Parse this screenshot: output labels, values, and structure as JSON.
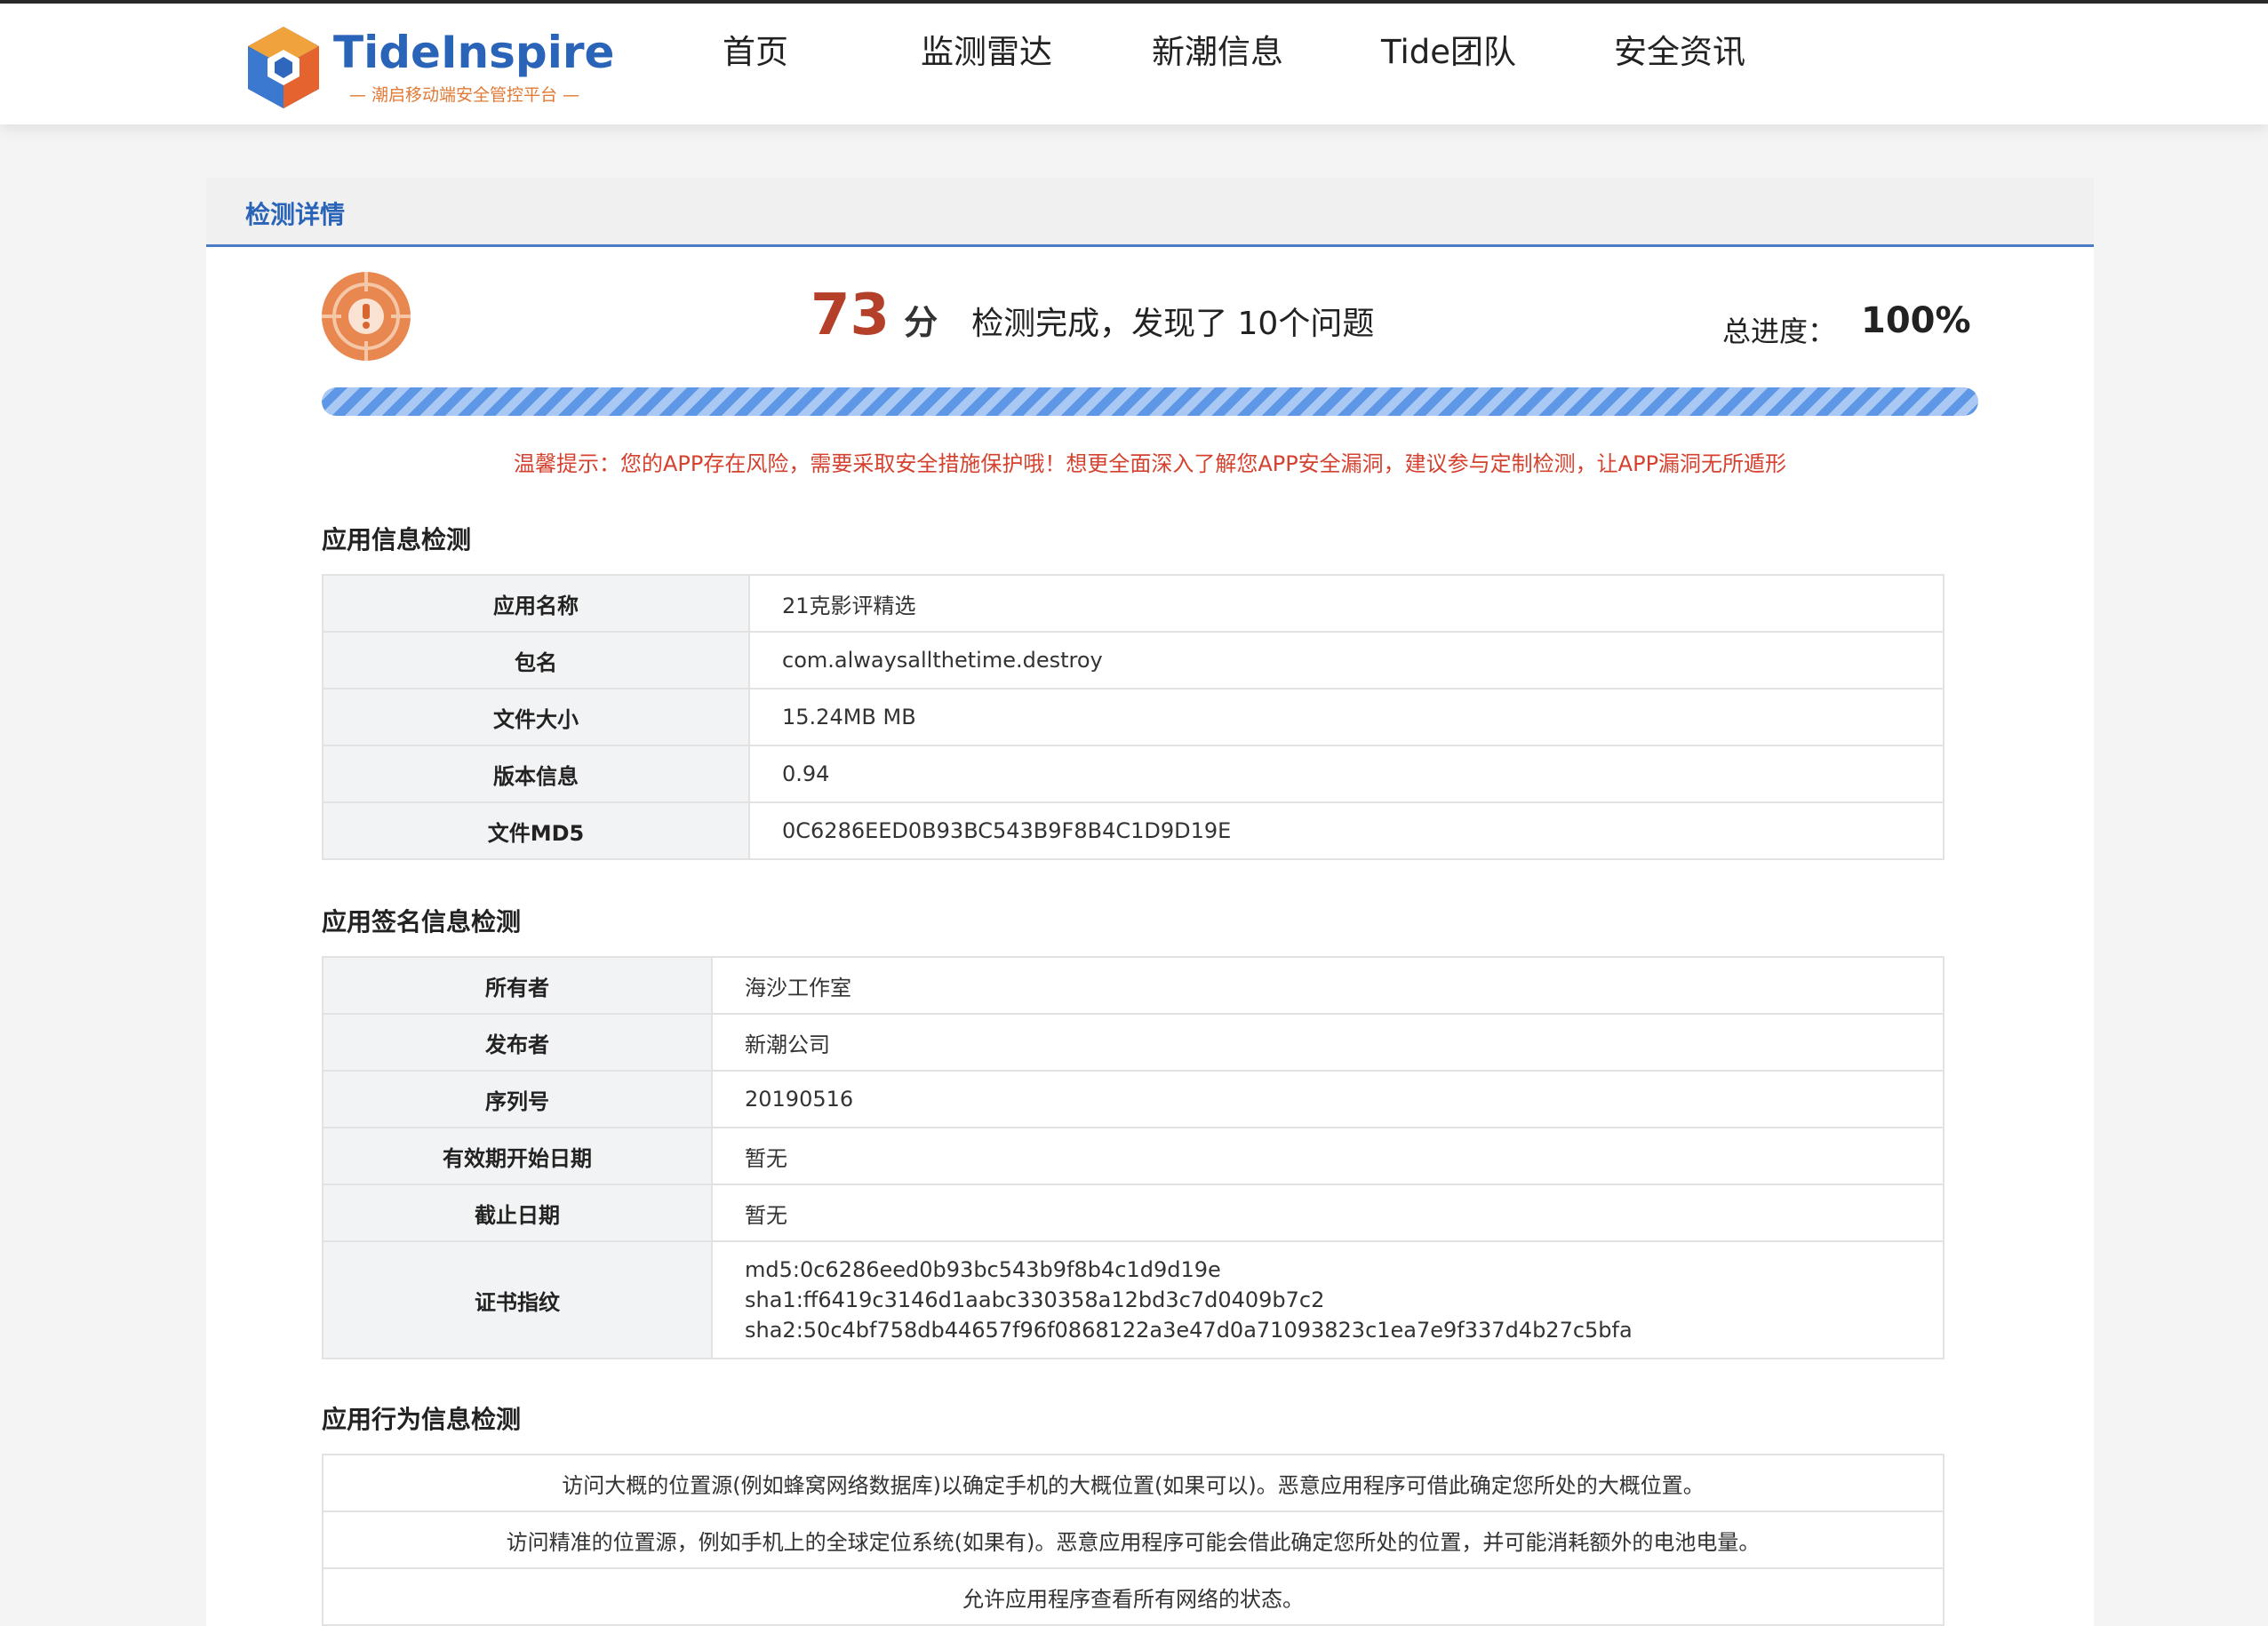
{
  "brand": {
    "name": "TideInspire",
    "tagline": "— 潮启移动端安全管控平台 —"
  },
  "nav": {
    "items": [
      "首页",
      "监测雷达",
      "新潮信息",
      "Tide团队",
      "安全资讯"
    ]
  },
  "tab": {
    "title": "检测详情"
  },
  "summary": {
    "score": "73",
    "score_unit": "分",
    "message": "检测完成，发现了 10个问题",
    "progress_label": "总进度：",
    "progress_value": "100%",
    "progress_fraction": 1.0,
    "tip": "温馨提示：您的APP存在风险，需要采取安全措施保护哦！想更全面深入了解您APP安全漏洞，建议参与定制检测，让APP漏洞无所遁形"
  },
  "app_info": {
    "title": "应用信息检测",
    "rows": [
      {
        "label": "应用名称",
        "value": "21克影评精选"
      },
      {
        "label": "包名",
        "value": "com.alwaysallthetime.destroy"
      },
      {
        "label": "文件大小",
        "value": "15.24MB MB"
      },
      {
        "label": "版本信息",
        "value": "0.94"
      },
      {
        "label": "文件MD5",
        "value": "0C6286EED0B93BC543B9F8B4C1D9D19E"
      }
    ]
  },
  "sign_info": {
    "title": "应用签名信息检测",
    "rows": [
      {
        "label": "所有者",
        "value": "海沙工作室"
      },
      {
        "label": "发布者",
        "value": "新潮公司"
      },
      {
        "label": "序列号",
        "value": "20190516"
      },
      {
        "label": "有效期开始日期",
        "value": "暂无"
      },
      {
        "label": "截止日期",
        "value": "暂无"
      }
    ],
    "fingerprint": {
      "label": "证书指纹",
      "md5": "md5:0c6286eed0b93bc543b9f8b4c1d9d19e",
      "sha1": "sha1:ff6419c3146d1aabc330358a12bd3c7d0409b7c2",
      "sha2": "sha2:50c4bf758db44657f96f0868122a3e47d0a71093823c1ea7e9f337d4b27c5bfa"
    }
  },
  "behavior": {
    "title": "应用行为信息检测",
    "rows": [
      "访问大概的位置源(例如蜂窝网络数据库)以确定手机的大概位置(如果可以)。恶意应用程序可借此确定您所处的大概位置。",
      "访问精准的位置源，例如手机上的全球定位系统(如果有)。恶意应用程序可能会借此确定您所处的位置，并可能消耗额外的电池电量。",
      "允许应用程序查看所有网络的状态。"
    ]
  },
  "colors": {
    "brand_blue": "#2a64b8",
    "score_red": "#b5402a",
    "tip_red": "#d4422f",
    "warn_orange": "#e8874f"
  },
  "icons": {
    "logo": "cube-logo-icon",
    "warning": "exclamation-target-icon"
  }
}
